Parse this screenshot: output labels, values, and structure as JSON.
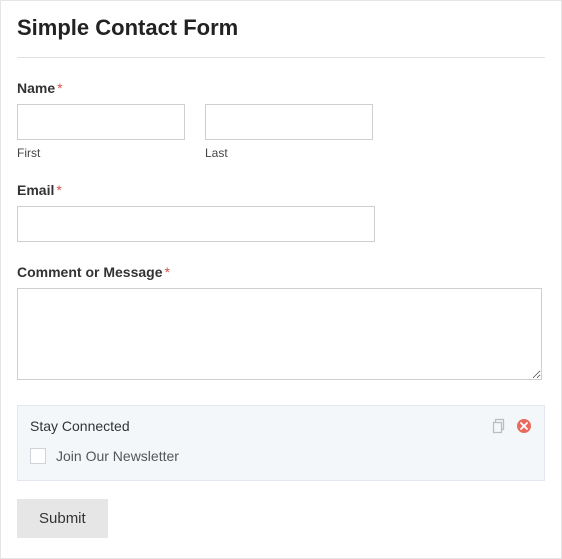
{
  "title": "Simple Contact Form",
  "fields": {
    "name": {
      "label": "Name",
      "required_marker": "*",
      "first_sub": "First",
      "last_sub": "Last",
      "first_value": "",
      "last_value": ""
    },
    "email": {
      "label": "Email",
      "required_marker": "*",
      "value": ""
    },
    "comment": {
      "label": "Comment or Message",
      "required_marker": "*",
      "value": ""
    }
  },
  "stay_connected": {
    "title": "Stay Connected",
    "checkbox_label": "Join Our Newsletter",
    "checked": false
  },
  "submit_label": "Submit"
}
